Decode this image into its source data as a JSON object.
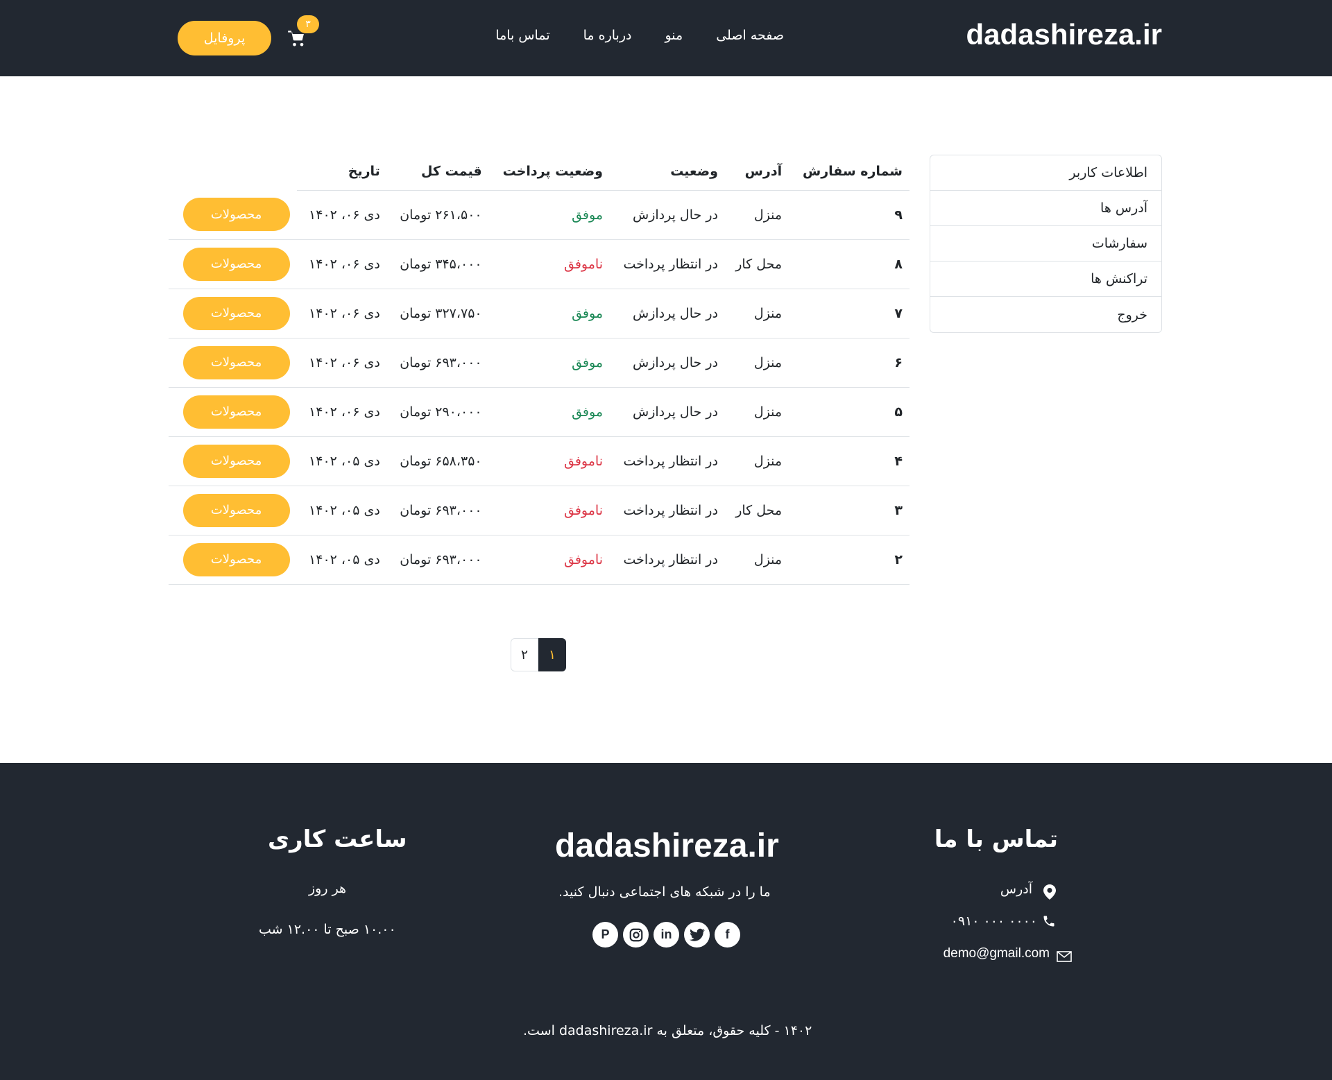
{
  "header": {
    "logo": "dadashireza.ir",
    "nav": [
      "صفحه اصلی",
      "منو",
      "درباره ما",
      "تماس باما"
    ],
    "cart_count": "۳",
    "profile_label": "پروفایل"
  },
  "sidebar": {
    "items": [
      "اطلاعات کاربر",
      "آدرس ها",
      "سفارشات",
      "تراکنش ها",
      "خروج"
    ]
  },
  "table": {
    "headers": [
      "شماره سفارش",
      "آدرس",
      "وضعیت",
      "وضعیت پرداخت",
      "قیمت کل",
      "تاریخ"
    ],
    "button_label": "محصولات",
    "rows": [
      {
        "num": "۹",
        "address": "منزل",
        "status": "در حال پردازش",
        "payment": "موفق",
        "payment_ok": true,
        "price": "۲۶۱،۵۰۰ تومان",
        "date": "دی ۰۶، ۱۴۰۲"
      },
      {
        "num": "۸",
        "address": "محل کار",
        "status": "در انتظار پرداخت",
        "payment": "ناموفق",
        "payment_ok": false,
        "price": "۳۴۵،۰۰۰ تومان",
        "date": "دی ۰۶، ۱۴۰۲"
      },
      {
        "num": "۷",
        "address": "منزل",
        "status": "در حال پردازش",
        "payment": "موفق",
        "payment_ok": true,
        "price": "۳۲۷،۷۵۰ تومان",
        "date": "دی ۰۶، ۱۴۰۲"
      },
      {
        "num": "۶",
        "address": "منزل",
        "status": "در حال پردازش",
        "payment": "موفق",
        "payment_ok": true,
        "price": "۶۹۳،۰۰۰ تومان",
        "date": "دی ۰۶، ۱۴۰۲"
      },
      {
        "num": "۵",
        "address": "منزل",
        "status": "در حال پردازش",
        "payment": "موفق",
        "payment_ok": true,
        "price": "۲۹۰،۰۰۰ تومان",
        "date": "دی ۰۶، ۱۴۰۲"
      },
      {
        "num": "۴",
        "address": "منزل",
        "status": "در انتظار پرداخت",
        "payment": "ناموفق",
        "payment_ok": false,
        "price": "۶۵۸،۳۵۰ تومان",
        "date": "دی ۰۵، ۱۴۰۲"
      },
      {
        "num": "۳",
        "address": "محل کار",
        "status": "در انتظار پرداخت",
        "payment": "ناموفق",
        "payment_ok": false,
        "price": "۶۹۳،۰۰۰ تومان",
        "date": "دی ۰۵، ۱۴۰۲"
      },
      {
        "num": "۲",
        "address": "منزل",
        "status": "در انتظار پرداخت",
        "payment": "ناموفق",
        "payment_ok": false,
        "price": "۶۹۳،۰۰۰ تومان",
        "date": "دی ۰۵، ۱۴۰۲"
      }
    ]
  },
  "pagination": {
    "active": "۱",
    "other": "۲"
  },
  "footer": {
    "contact_title": "تماس با ما",
    "address_label": "آدرس",
    "phone": "۰۹۱۰ ۰۰۰ ۰۰۰۰",
    "email": "demo@gmail.com",
    "logo": "dadashireza.ir",
    "follow_text": "ما را در شبکه های اجتماعی دنبال کنید.",
    "socials": [
      "pinterest-icon",
      "instagram-icon",
      "linkedin-icon",
      "twitter-icon",
      "facebook-icon"
    ],
    "hours_title": "ساعت کاری",
    "hours_days": "هر روز",
    "hours_time": "۱۰.۰۰ صبح تا ۱۲.۰۰ شب",
    "copyright": "۱۴۰۲ - کلیه حقوق، متعلق به dadashireza.ir است."
  },
  "colors": {
    "accent": "#ffbe33",
    "dark": "#222831",
    "success": "#198754",
    "danger": "#dc3545"
  }
}
